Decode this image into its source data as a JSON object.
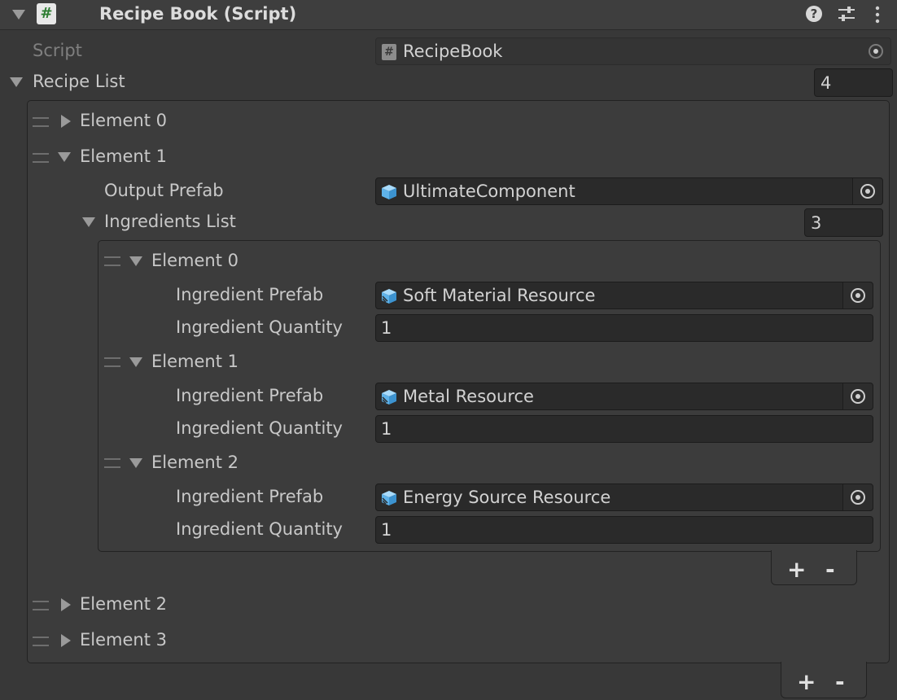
{
  "component": {
    "title": "Recipe Book (Script)",
    "script_label": "Script",
    "script_value": "RecipeBook"
  },
  "recipe_list": {
    "label": "Recipe List",
    "count": "4",
    "elements": [
      "Element 0",
      "Element 1",
      "Element 2",
      "Element 3"
    ],
    "element1": {
      "output_prefab_label": "Output Prefab",
      "output_prefab_value": "UltimateComponent",
      "ingredients_label": "Ingredients List",
      "ingredients_count": "3",
      "ingredients": [
        {
          "title": "Element 0",
          "prefab_label": "Ingredient Prefab",
          "prefab_value": "Soft Material Resource",
          "quantity_label": "Ingredient Quantity",
          "quantity_value": "1"
        },
        {
          "title": "Element 1",
          "prefab_label": "Ingredient Prefab",
          "prefab_value": "Metal Resource",
          "quantity_label": "Ingredient Quantity",
          "quantity_value": "1"
        },
        {
          "title": "Element 2",
          "prefab_label": "Ingredient Prefab",
          "prefab_value": "Energy Source Resource",
          "quantity_label": "Ingredient Quantity",
          "quantity_value": "1"
        }
      ]
    }
  },
  "buttons": {
    "add": "+",
    "remove": "-"
  },
  "icons": {
    "script": "hash-script-icon",
    "prefab": "prefab-cube-icon",
    "picker": "object-picker-icon",
    "help": "help-icon",
    "presets": "presets-icon",
    "menu": "kebab-menu-icon"
  },
  "colors": {
    "background": "#383838",
    "field": "#2a2a2a",
    "text": "#d2d2d2",
    "script_icon": "#4caf50",
    "prefab_icon": "#7cc5f5"
  }
}
